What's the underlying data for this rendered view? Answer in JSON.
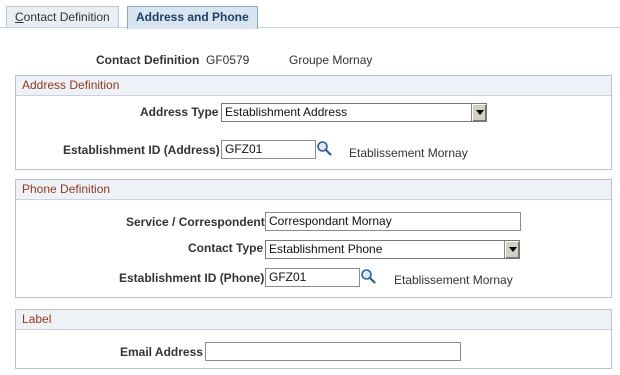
{
  "tabs": [
    {
      "prefix": "",
      "underline": "C",
      "rest": "ontact Definition"
    },
    {
      "label": "Address and Phone"
    }
  ],
  "header": {
    "contact_definition_label": "Contact Definition",
    "contact_definition_value": "GF0579",
    "contact_definition_name": "Groupe Mornay"
  },
  "address": {
    "title": "Address Definition",
    "address_type_label": "Address Type",
    "address_type_value": "Establishment Address",
    "establishment_id_label": "Establishment ID (Address)",
    "establishment_id_value": "GFZ01",
    "establishment_name": "Etablissement Mornay"
  },
  "phone": {
    "title": "Phone Definition",
    "service_label": "Service / Correspondent",
    "service_value": "Correspondant Mornay",
    "contact_type_label": "Contact Type",
    "contact_type_value": "Establishment Phone",
    "establishment_id_label": "Establishment ID (Phone)",
    "establishment_id_value": "GFZ01",
    "establishment_name": "Etablissement Mornay"
  },
  "label_section": {
    "title": "Label",
    "email_label": "Email Address",
    "email_value": ""
  },
  "colors": {
    "group_title": "#8e3a1c",
    "active_tab_text": "#1d3f66"
  }
}
